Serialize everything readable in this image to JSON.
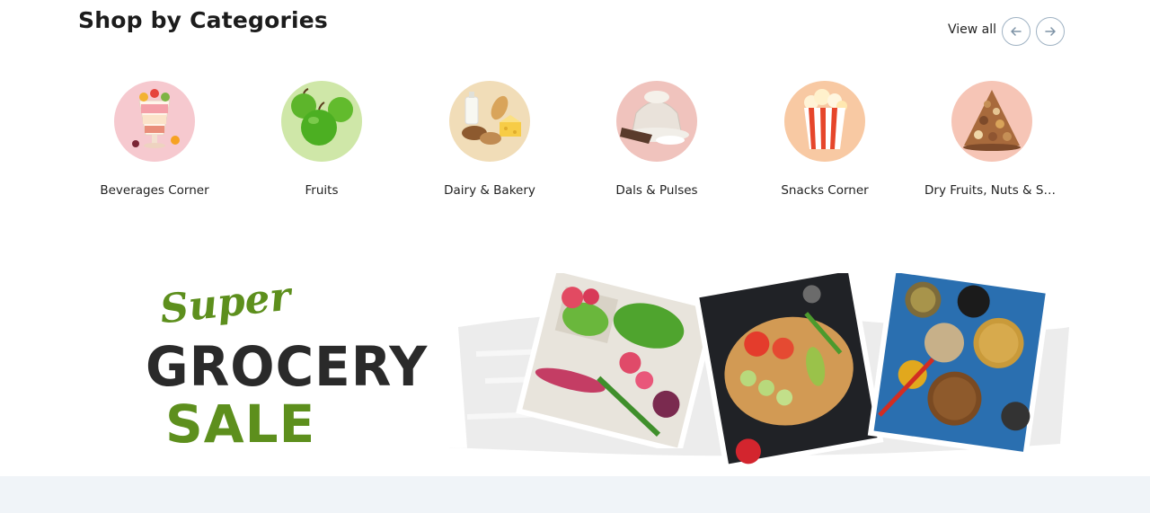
{
  "section": {
    "title": "Shop by Categories",
    "view_all": "View all"
  },
  "categories": [
    {
      "label": "Beverages Corner",
      "bg": "#f6c9cf"
    },
    {
      "label": "Fruits",
      "bg": "#cfe7a8"
    },
    {
      "label": "Dairy & Bakery",
      "bg": "#f1ddb8"
    },
    {
      "label": "Dals & Pulses",
      "bg": "#f0c3bd"
    },
    {
      "label": "Snacks Corner",
      "bg": "#f8c9a3"
    },
    {
      "label": "Dry Fruits, Nuts & Se...",
      "bg": "#f6c5b6"
    }
  ],
  "banner": {
    "line1": "Super",
    "line2": "GROCERY",
    "line3": "SALE"
  },
  "colors": {
    "accent_green": "#5d8f1d",
    "dark_text": "#2a2a2a",
    "strip_bg": "#f0f4f8"
  }
}
